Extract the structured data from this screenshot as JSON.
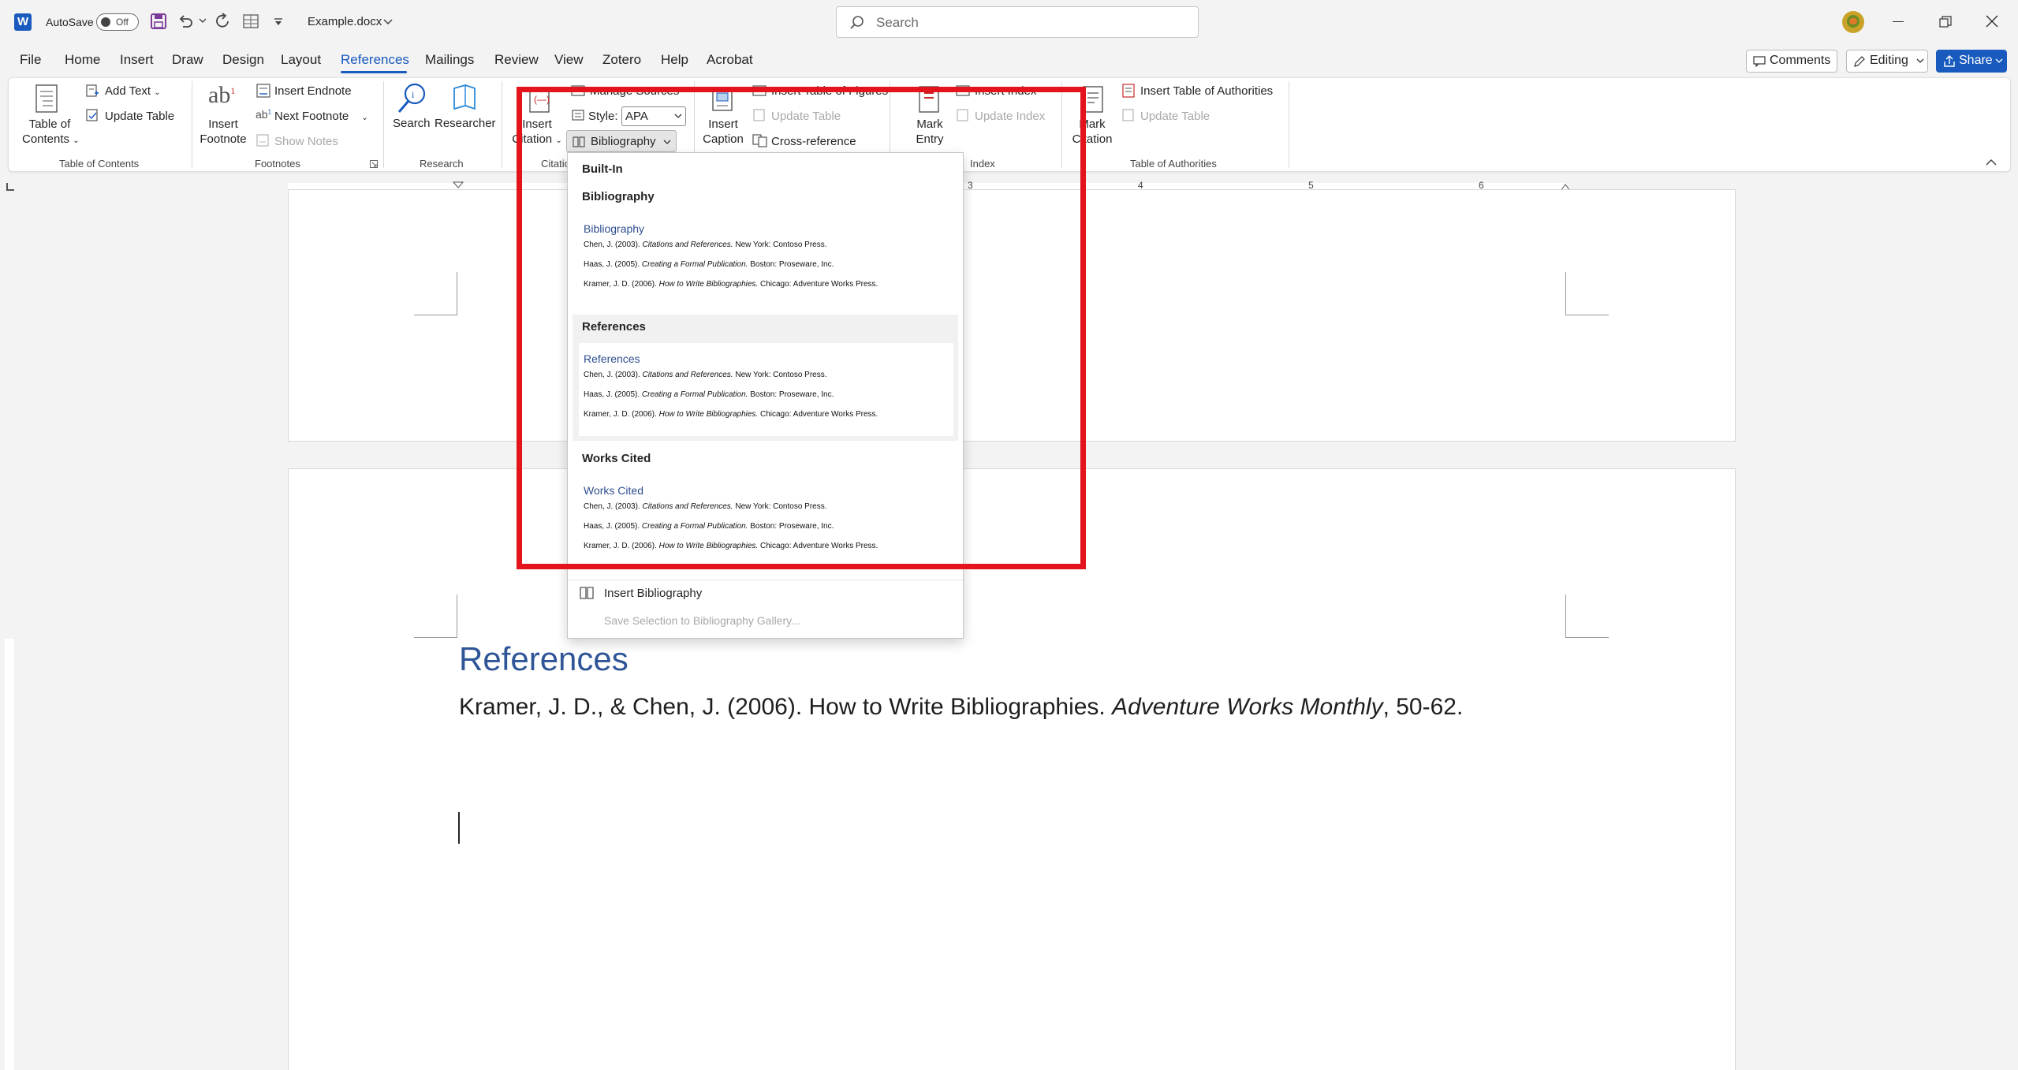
{
  "titlebar": {
    "autosave_label": "AutoSave",
    "autosave_state": "Off",
    "filename": "Example.docx",
    "search_placeholder": "Search"
  },
  "menu": {
    "tabs": [
      "File",
      "Home",
      "Insert",
      "Draw",
      "Design",
      "Layout",
      "References",
      "Mailings",
      "Review",
      "View",
      "Zotero",
      "Help",
      "Acrobat"
    ],
    "active_tab": "References",
    "comments_label": "Comments",
    "editing_label": "Editing",
    "share_label": "Share"
  },
  "ribbon": {
    "toc": {
      "table_of_contents_l1": "Table of",
      "table_of_contents_l2": "Contents",
      "add_text": "Add Text",
      "update_table": "Update Table",
      "group": "Table of Contents"
    },
    "footnotes": {
      "insert_footnote_l1": "Insert",
      "insert_footnote_l2": "Footnote",
      "insert_endnote": "Insert Endnote",
      "next_footnote": "Next Footnote",
      "show_notes": "Show Notes",
      "group": "Footnotes"
    },
    "research": {
      "search": "Search",
      "researcher": "Researcher",
      "group": "Research"
    },
    "citations": {
      "insert_citation_l1": "Insert",
      "insert_citation_l2": "Citation",
      "manage_sources": "Manage Sources",
      "style_label": "Style:",
      "style_value": "APA",
      "bibliography": "Bibliography",
      "group": "Citatio"
    },
    "captions": {
      "insert_caption_l1": "Insert",
      "insert_caption_l2": "Caption",
      "insert_table_of_figures": "Insert Table of Figures",
      "update_table": "Update Table",
      "cross_reference": "Cross-reference"
    },
    "index": {
      "mark_entry_l1": "Mark",
      "mark_entry_l2": "Entry",
      "insert_index": "Insert Index",
      "update_index": "Update Index",
      "group": "Index"
    },
    "authorities": {
      "mark_citation_l1": "Mark",
      "mark_citation_l2": "Citation",
      "insert_table_of_authorities": "Insert Table of Authorities",
      "update_table": "Update Table",
      "group": "Table of Authorities"
    }
  },
  "ruler": {
    "numbers": [
      "3",
      "4",
      "5",
      "6"
    ]
  },
  "dropdown": {
    "section_header": "Built-In",
    "items": [
      {
        "header": "Bibliography",
        "title": "Bibliography",
        "lines": [
          {
            "pre": "Chen, J. (2003). ",
            "ital": "Citations and References.",
            "post": " New York: Contoso Press."
          },
          {
            "pre": "Haas, J. (2005). ",
            "ital": "Creating a Formal Publication.",
            "post": " Boston: Proseware, Inc."
          },
          {
            "pre": "Kramer, J. D. (2006). ",
            "ital": "How to Write Bibliographies.",
            "post": " Chicago: Adventure Works Press."
          }
        ]
      },
      {
        "header": "References",
        "title": "References",
        "lines": [
          {
            "pre": "Chen, J. (2003). ",
            "ital": "Citations and References.",
            "post": " New York: Contoso Press."
          },
          {
            "pre": "Haas, J. (2005). ",
            "ital": "Creating a Formal Publication.",
            "post": " Boston: Proseware, Inc."
          },
          {
            "pre": "Kramer, J. D. (2006). ",
            "ital": "How to Write Bibliographies.",
            "post": " Chicago: Adventure Works Press."
          }
        ]
      },
      {
        "header": "Works Cited",
        "title": "Works Cited",
        "lines": [
          {
            "pre": "Chen, J. (2003). ",
            "ital": "Citations and References.",
            "post": " New York: Contoso Press."
          },
          {
            "pre": "Haas, J. (2005). ",
            "ital": "Creating a Formal Publication.",
            "post": " Boston: Proseware, Inc."
          },
          {
            "pre": "Kramer, J. D. (2006). ",
            "ital": "How to Write Bibliographies.",
            "post": " Chicago: Adventure Works Press."
          }
        ]
      }
    ],
    "insert_bibliography": "Insert Bibliography",
    "save_selection": "Save Selection to Bibliography Gallery..."
  },
  "document": {
    "heading": "References",
    "body_pre": "Kramer, J. D., & Chen, J. (2006). How to Write Bibliographies. ",
    "body_italic": "Adventure Works Monthly",
    "body_post": ", 50-62."
  },
  "colors": {
    "accent": "#185abd",
    "highlight": "#e3141c",
    "heading": "#2f5597"
  }
}
